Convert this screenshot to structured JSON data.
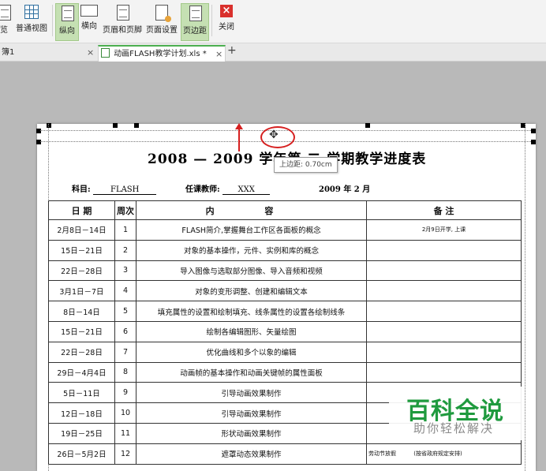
{
  "ribbon": {
    "buttons": [
      {
        "label": "览"
      },
      {
        "label": "普通视图"
      },
      {
        "label": "纵向"
      },
      {
        "label": "横向"
      },
      {
        "label": "页眉和页脚"
      },
      {
        "label": "页面设置"
      },
      {
        "label": "页边距"
      },
      {
        "label": "关闭"
      }
    ]
  },
  "tabs": [
    {
      "label": "簿1",
      "close": "×"
    },
    {
      "label": "动画FLASH教学计划.xls *",
      "close": "×"
    }
  ],
  "new_tab": "+",
  "tooltip": "上边距: 0.70cm",
  "sheet": {
    "title": "2008 — 2009 学年第 二 学期教学进度表",
    "subject_label": "科目:",
    "subject_value": "FLASH",
    "teacher_label": "任课教师:",
    "teacher_value": "XXX",
    "date": "2009 年 2 月",
    "headers": [
      "日 期",
      "周次",
      "内 容",
      "备 注"
    ],
    "rows": [
      {
        "date": "2月8日－14日",
        "week": "1",
        "content": "FLASH简介,掌握舞台工作区各面板的概念",
        "note": "2月9日开学, 上课"
      },
      {
        "date": "15日－21日",
        "week": "2",
        "content": "对象的基本操作，元件、实例和库的概念",
        "note": ""
      },
      {
        "date": "22日－28日",
        "week": "3",
        "content": "导入图像与选取部分图像、导入音频和视频",
        "note": ""
      },
      {
        "date": "3月1日－7日",
        "week": "4",
        "content": "对象的变形调整、创建和编辑文本",
        "note": ""
      },
      {
        "date": "8日－14日",
        "week": "5",
        "content": "填充属性的设置和绘制填充、线条属性的设置各绘制线条",
        "note": ""
      },
      {
        "date": "15日－21日",
        "week": "6",
        "content": "绘制各编辑图形、矢量绘图",
        "note": ""
      },
      {
        "date": "22日－28日",
        "week": "7",
        "content": "优化曲线和多个以象的编辑",
        "note": ""
      },
      {
        "date": "29日－4月4日",
        "week": "8",
        "content": "动画帧的基本操作和动画关键帧的属性面板",
        "note": ""
      },
      {
        "date": "5日－11日",
        "week": "9",
        "content": "引导动画效果制作",
        "note": ""
      },
      {
        "date": "12日－18日",
        "week": "10",
        "content": "引导动画效果制作",
        "note": ""
      },
      {
        "date": "19日－25日",
        "week": "11",
        "content": "形状动画效果制作",
        "note": ""
      },
      {
        "date": "26日－5月2日",
        "week": "12",
        "content": "遮罩动态效果制作",
        "note": "劳动节放假          (按省政府规定安排)"
      }
    ]
  },
  "watermark": {
    "main": "百科全说",
    "sub": "助你轻松解决"
  },
  "colors": {
    "accent_green": "#4caf50",
    "annotation_red": "#d62020",
    "watermark_green": "#1f9a3e"
  }
}
